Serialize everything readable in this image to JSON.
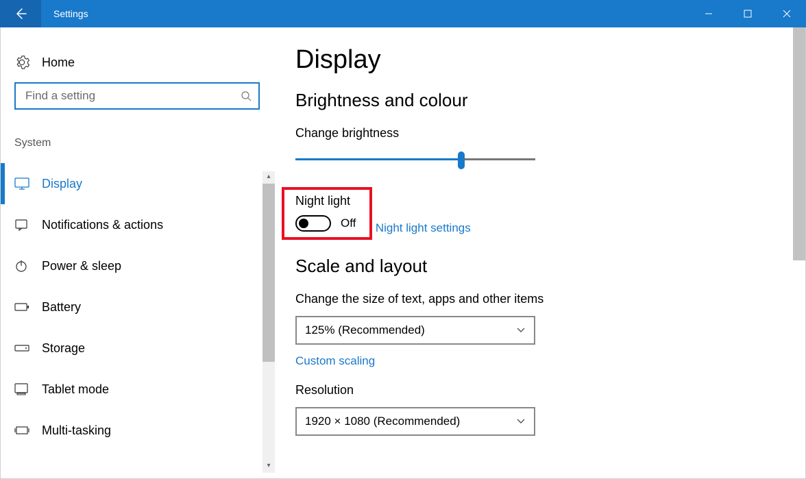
{
  "titlebar": {
    "title": "Settings"
  },
  "sidebar": {
    "home": "Home",
    "search_placeholder": "Find a setting",
    "section": "System",
    "items": [
      {
        "label": "Display",
        "active": true
      },
      {
        "label": "Notifications & actions",
        "active": false
      },
      {
        "label": "Power & sleep",
        "active": false
      },
      {
        "label": "Battery",
        "active": false
      },
      {
        "label": "Storage",
        "active": false
      },
      {
        "label": "Tablet mode",
        "active": false
      },
      {
        "label": "Multi-tasking",
        "active": false
      }
    ]
  },
  "main": {
    "page_title": "Display",
    "section_brightness": "Brightness and colour",
    "change_brightness": "Change brightness",
    "brightness_percent": 69,
    "night_light": {
      "label": "Night light",
      "state": "Off",
      "enabled": false,
      "settings_link": "Night light settings"
    },
    "section_scale": "Scale and layout",
    "scale_label": "Change the size of text, apps and other items",
    "scale_value": "125% (Recommended)",
    "custom_scaling_link": "Custom scaling",
    "resolution_label": "Resolution",
    "resolution_value": "1920 × 1080 (Recommended)"
  }
}
